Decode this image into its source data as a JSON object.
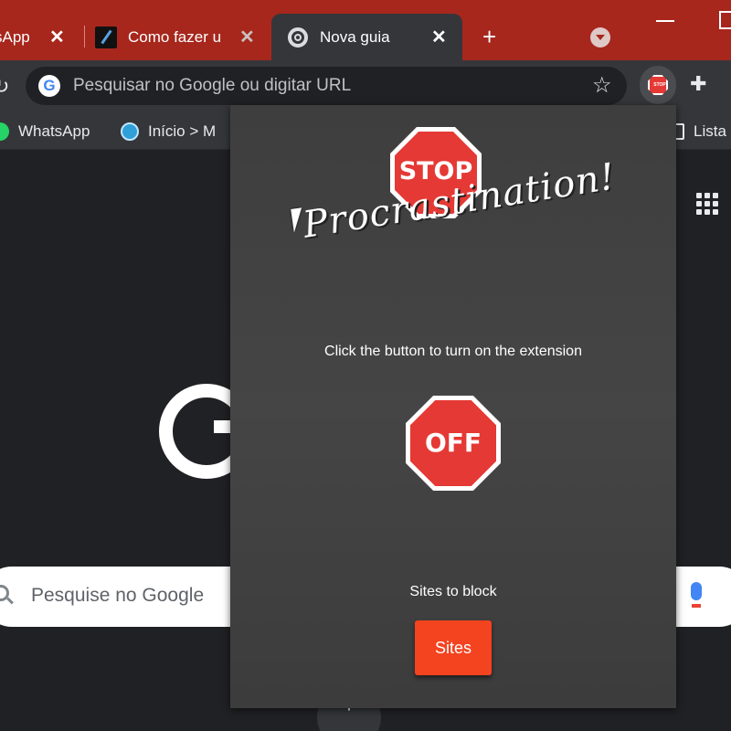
{
  "tabs": [
    {
      "title": "sApp",
      "close": "✕",
      "active": false
    },
    {
      "title": "Como fazer u",
      "close": "✕",
      "active": false
    },
    {
      "title": "Nova guia",
      "close": "✕",
      "active": true
    }
  ],
  "tabstrip": {
    "new_tab": "+"
  },
  "toolbar": {
    "omnibox_placeholder": "Pesquisar no Google ou digitar URL",
    "extension_icon_text": "STOP"
  },
  "bookmarks": [
    {
      "label": "WhatsApp"
    },
    {
      "label": "Início > M"
    },
    {
      "label": "Lista"
    }
  ],
  "ntp": {
    "search_placeholder": "Pesquise no Google",
    "add_shortcut": "+"
  },
  "popup": {
    "logo_stop": "STOP",
    "logo_script": "Procrastination!",
    "instruction": "Click the button to turn on the extension",
    "toggle_label": "OFF",
    "sites_label": "Sites to block",
    "sites_button": "Sites"
  },
  "colors": {
    "tabstrip": "#a7271d",
    "toolbar": "#35363a",
    "page_bg": "#202124",
    "popup_bg": "#414141",
    "stop_red": "#e53935",
    "button_red": "#f4431f"
  }
}
